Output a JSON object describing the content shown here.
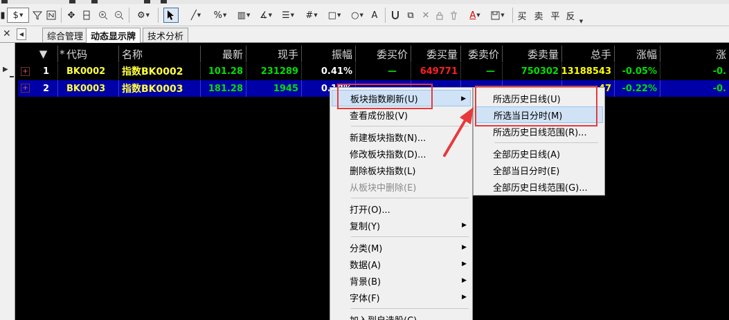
{
  "toolbar": {
    "dollar": "$",
    "chinese_buttons": [
      "买",
      "卖",
      "平",
      "反"
    ],
    "text_tool": "A"
  },
  "tabs": [
    "综合管理",
    "动态显示牌",
    "技术分析"
  ],
  "grid": {
    "sort_marker": "▼",
    "star": "*",
    "columns": [
      "代码",
      "名称",
      "最新",
      "现手",
      "振幅",
      "委买价",
      "委买量",
      "委卖价",
      "委卖量",
      "总手",
      "涨幅",
      "涨"
    ],
    "rows": [
      {
        "index": "1",
        "code": "BK0002",
        "name": "指数BK0002",
        "last": "101.28",
        "volume": "231289",
        "amplitude": "0.41%",
        "bid": "—",
        "bid_vol": "649771",
        "ask": "—",
        "ask_vol": "750302",
        "total": "13188543",
        "change": "-0.05%",
        "extra": "-0."
      },
      {
        "index": "2",
        "code": "BK0003",
        "name": "指数BK0003",
        "last": "181.28",
        "volume": "1945",
        "amplitude": "0.18%",
        "bid": "",
        "bid_vol": "",
        "ask": "",
        "ask_vol": "",
        "total": "47",
        "change": "-0.22%",
        "extra": "-0."
      }
    ]
  },
  "context_menu": {
    "items": [
      {
        "label": "板块指数刷新(U)",
        "submenu": true,
        "highlighted": true
      },
      {
        "label": "查看成份股(V)"
      },
      {
        "label": "新建板块指数(N)..."
      },
      {
        "label": "修改板块指数(D)..."
      },
      {
        "label": "删除板块指数(L)"
      },
      {
        "label": "从板块中删除(E)",
        "disabled": true
      },
      {
        "label": "打开(O)..."
      },
      {
        "label": "复制(Y)",
        "submenu": true
      },
      {
        "label": "分类(M)",
        "submenu": true
      },
      {
        "label": "数据(A)",
        "submenu": true
      },
      {
        "label": "背景(B)",
        "submenu": true
      },
      {
        "label": "字体(F)",
        "submenu": true
      },
      {
        "label": "加入到自选股(C)"
      }
    ]
  },
  "submenu": {
    "items": [
      {
        "label": "所选历史日线(U)"
      },
      {
        "label": "所选当日分时(M)",
        "highlighted": true
      },
      {
        "label": "所选历史日线范围(R)..."
      },
      {
        "label": "全部历史日线(A)"
      },
      {
        "label": "全部当日分时(E)"
      },
      {
        "label": "全部历史日线范围(G)..."
      }
    ]
  },
  "colors": {
    "annotation": "#e8393a",
    "selection_row": "#0000a8",
    "menu_highlight": "#cfe2f6"
  }
}
